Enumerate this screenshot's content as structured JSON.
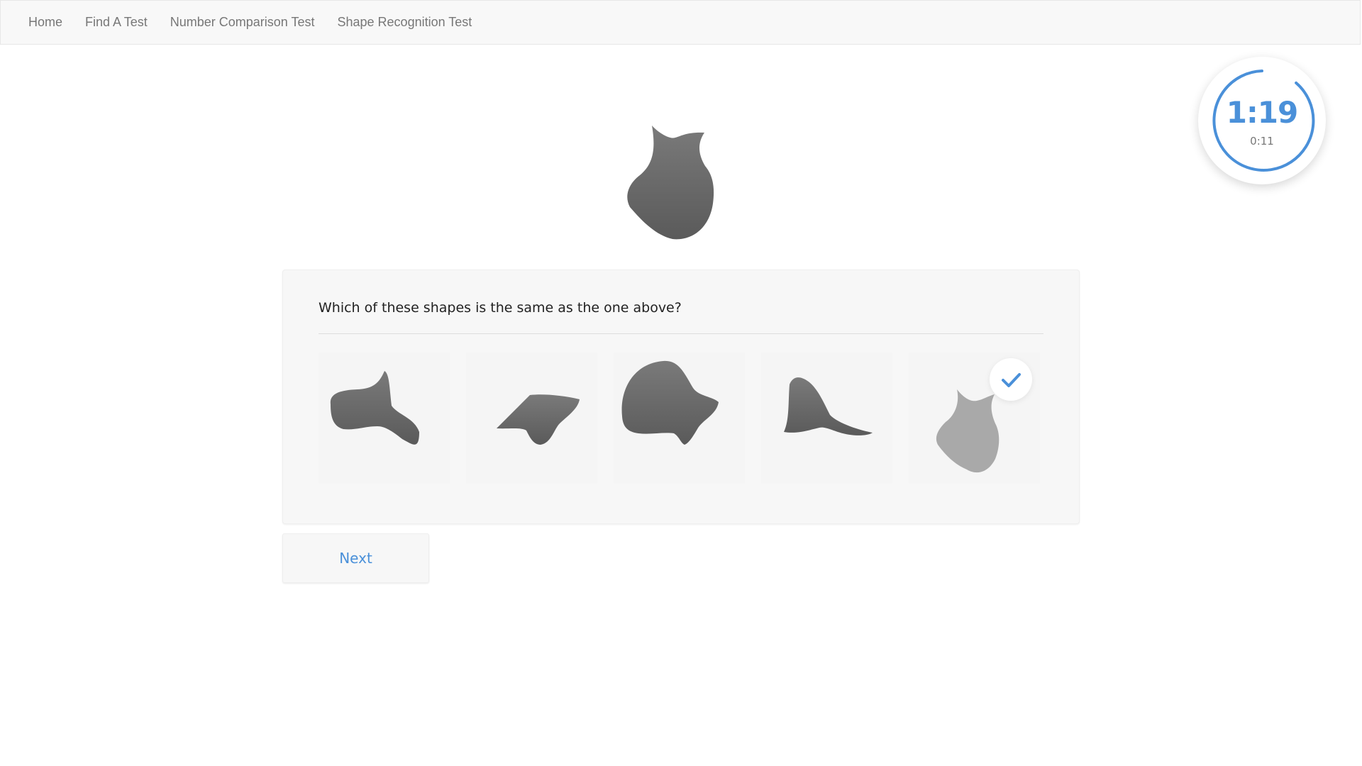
{
  "nav": {
    "items": [
      {
        "label": "Home"
      },
      {
        "label": "Find A Test"
      },
      {
        "label": "Number Comparison Test"
      },
      {
        "label": "Shape Recognition Test"
      }
    ]
  },
  "timer": {
    "main": "1:19",
    "sub": "0:11",
    "accent": "#4a90d9"
  },
  "question": {
    "text": "Which of these shapes is the same as the one above?"
  },
  "options": {
    "count": 5,
    "selected_index": 5,
    "selected_indicator": "check-icon"
  },
  "actions": {
    "next_label": "Next"
  },
  "colors": {
    "accent": "#4a90d9",
    "shape_dark": "#5e5e5e",
    "shape_selected": "#a9a9a9"
  }
}
